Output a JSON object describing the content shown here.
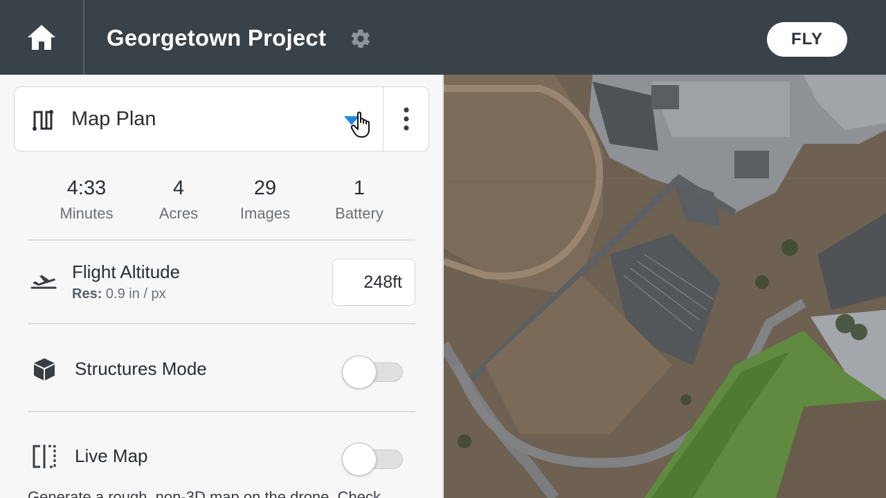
{
  "header": {
    "title": "Georgetown Project",
    "fly_label": "FLY",
    "home_icon": "home-icon",
    "settings_icon": "gear-icon"
  },
  "plan": {
    "label": "Map Plan",
    "icon": "map-plan-icon",
    "dropdown_icon": "caret-down-icon",
    "more_icon": "more-vertical-icon",
    "accent_color": "#1e88e5"
  },
  "stats": [
    {
      "value": "4:33",
      "label": "Minutes"
    },
    {
      "value": "4",
      "label": "Acres"
    },
    {
      "value": "29",
      "label": "Images"
    },
    {
      "value": "1",
      "label": "Battery"
    }
  ],
  "altitude": {
    "title": "Flight Altitude",
    "res_label": "Res:",
    "res_value": "0.9 in / px",
    "value": "248ft",
    "icon": "takeoff-icon"
  },
  "structures_mode": {
    "label": "Structures Mode",
    "icon": "cube-icon",
    "enabled": false
  },
  "live_map": {
    "label": "Live Map",
    "icon": "live-map-icon",
    "enabled": false
  },
  "footer_partial": "Generate a rough, non-3D map on the drone. Check",
  "colors": {
    "header_bg": "#3a4249",
    "panel_bg": "#f7f7f7"
  }
}
